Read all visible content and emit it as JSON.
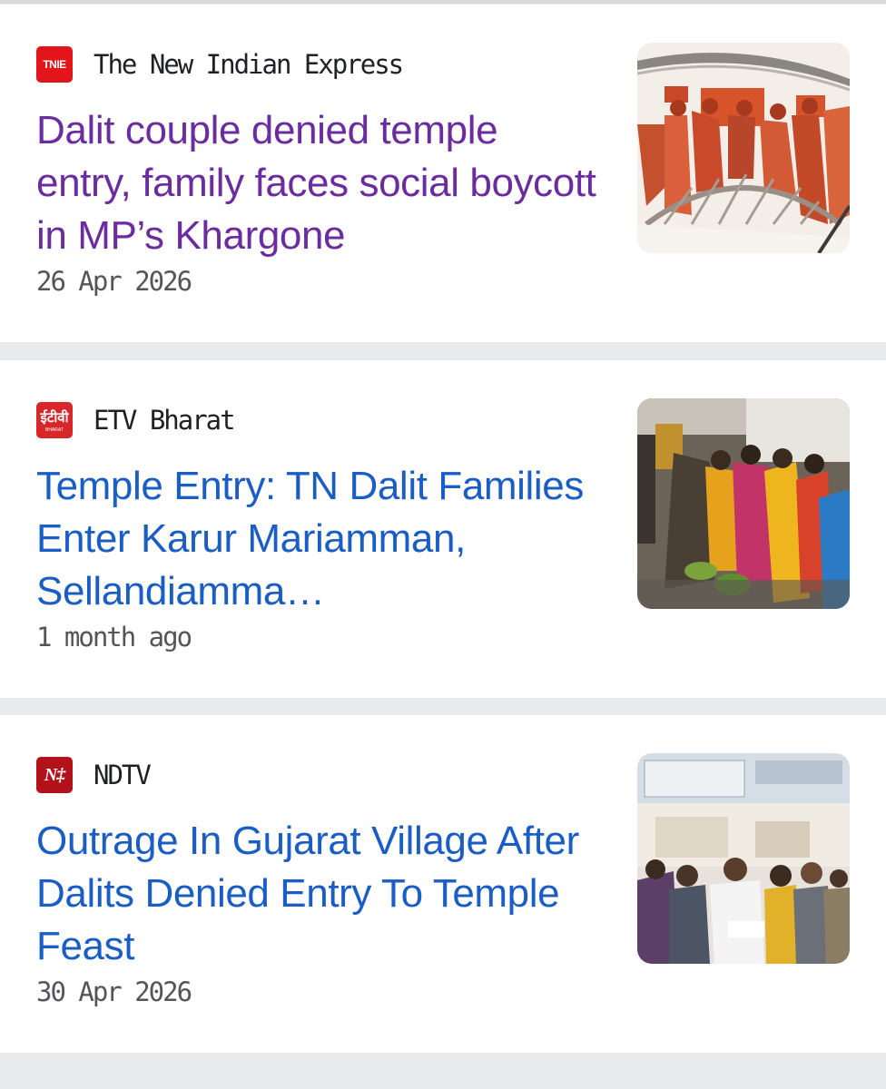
{
  "articles": [
    {
      "source": "The New Indian Express",
      "logo_text": "TNIE",
      "headline": "Dalit couple denied temple entry, family faces social boycott in MP’s Khargone",
      "date": "26 Apr 2026",
      "visited": true,
      "thumb_icon": "protest-illustration-thumbnail"
    },
    {
      "source": "ETV Bharat",
      "logo_text": "ईटीवी",
      "logo_sub": "BHARAT",
      "headline": "Temple Entry: TN Dalit Families Enter Karur Mariamman, Sellandiamma…",
      "date": "1 month ago",
      "visited": false,
      "thumb_icon": "temple-crowd-thumbnail"
    },
    {
      "source": "NDTV",
      "logo_text": "N‡",
      "headline": "Outrage In Gujarat Village After Dalits Denied Entry To Temple Feast",
      "date": "30 Apr 2026",
      "visited": false,
      "thumb_icon": "group-photo-thumbnail"
    }
  ],
  "colors": {
    "visited_link": "#6a2c9f",
    "link": "#1a5dc4",
    "tnie_red": "#e4141b",
    "etv_red": "#d8262b",
    "ndtv_red": "#b3121a"
  }
}
